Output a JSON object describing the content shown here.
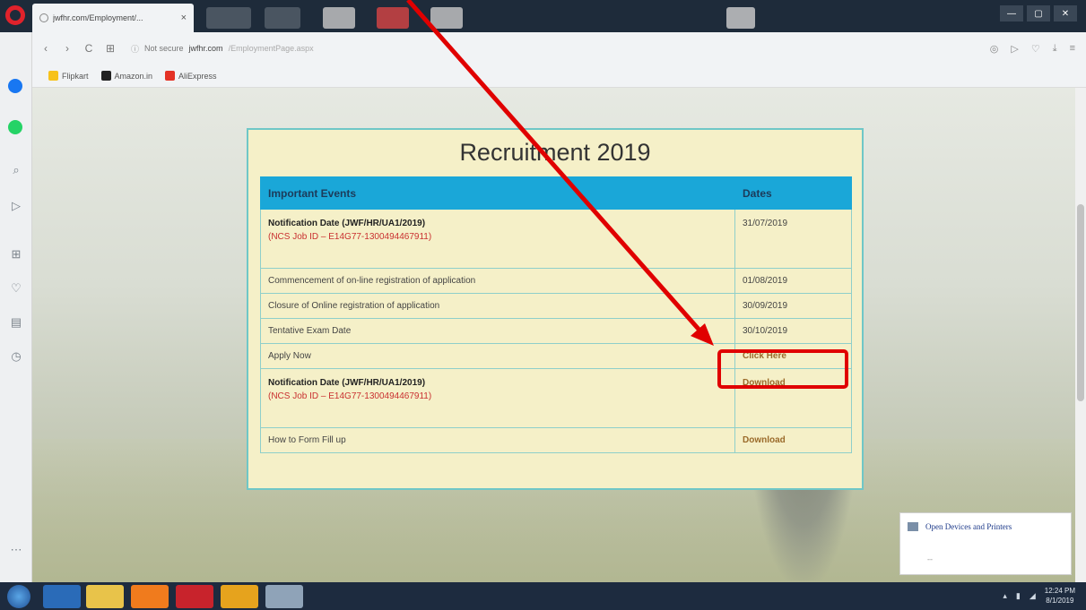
{
  "browser": {
    "tab_title": "jwfhr.com/Employment/...",
    "tab_close": "×",
    "win_min": "—",
    "win_max": "▢",
    "win_close": "✕",
    "url_security": "Not secure",
    "url_host": "jwfhr.com",
    "url_path": "/EmploymentPage.aspx",
    "nav_back": "‹",
    "nav_forward": "›",
    "nav_reload": "C",
    "nav_tabs": "⊞"
  },
  "bookmarks": [
    {
      "label": "Flipkart",
      "color": "#f7c21b"
    },
    {
      "label": "Amazon.in",
      "color": "#222222"
    },
    {
      "label": "AliExpress",
      "color": "#e43225"
    }
  ],
  "page": {
    "title": "Recruitment 2019",
    "table": {
      "headers": [
        "Important Events",
        "Dates"
      ],
      "rows": [
        {
          "event_bold": "Notification Date (JWF/HR/UA1/2019)",
          "event_red": "(NCS Job ID – E14G77-1300494467911)",
          "date": "31/07/2019"
        },
        {
          "event": "Commencement of on-line registration of application",
          "date": "01/08/2019"
        },
        {
          "event": "Closure of Online registration of application",
          "date": "30/09/2019"
        },
        {
          "event": "Tentative Exam Date",
          "date": "30/10/2019"
        },
        {
          "event": "Apply Now",
          "link": "Click Here"
        },
        {
          "event_bold": "Notification Date (JWF/HR/UA1/2019)",
          "event_red": "(NCS Job ID – E14G77-1300494467911)",
          "link": "Download"
        },
        {
          "event": "How to Form Fill up",
          "link": "Download"
        }
      ]
    }
  },
  "popup": {
    "label": "Open Devices and Printers",
    "dash": "--"
  },
  "taskbar": {
    "time": "12:24 PM",
    "date": "8/1/2019"
  },
  "colors": {
    "highlight": "#e00000",
    "table_header": "#1aa7d8",
    "card_bg": "#f5f0c8"
  }
}
